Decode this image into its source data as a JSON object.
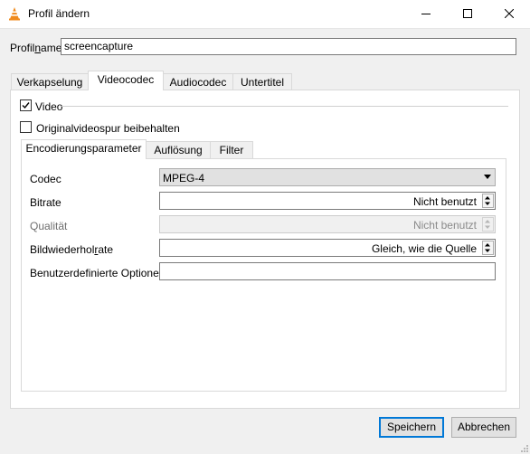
{
  "window": {
    "title": "Profil ändern",
    "icon": "vlc-cone-icon",
    "controls": [
      "minimize-icon",
      "maximize-icon",
      "close-icon"
    ]
  },
  "profile": {
    "label_pre": "Profil",
    "label_accel": "n",
    "label_post": "ame",
    "value": "screencapture"
  },
  "tabs": [
    {
      "label": "Verkapselung",
      "active": false
    },
    {
      "label": "Videocodec",
      "active": true
    },
    {
      "label": "Audiocodec",
      "active": false
    },
    {
      "label": "Untertitel",
      "active": false
    }
  ],
  "video": {
    "checkbox_label": "Video",
    "checked": true,
    "keep_original_label": "Originalvideospur beibehalten",
    "keep_original_checked": false
  },
  "subtabs": [
    {
      "label": "Encodierungsparameter",
      "active": true
    },
    {
      "label": "Auflösung",
      "active": false
    },
    {
      "label": "Filter",
      "active": false
    }
  ],
  "fields": {
    "codec": {
      "label": "Codec",
      "value": "MPEG-4"
    },
    "bitrate": {
      "label": "Bitrate",
      "value": "Nicht benutzt"
    },
    "quality": {
      "label": "Qualität",
      "value": "Nicht benutzt",
      "disabled": true
    },
    "framerate": {
      "label_pre": "Bildwiederhol",
      "label_accel": "r",
      "label_post": "ate",
      "value": "Gleich, wie die Quelle"
    },
    "custom": {
      "label": "Benutzerdefinierte Optionen",
      "value": ""
    }
  },
  "buttons": {
    "save": "Speichern",
    "cancel": "Abbrechen"
  },
  "colors": {
    "accent": "#0078d7",
    "background": "#f0f0f0"
  }
}
